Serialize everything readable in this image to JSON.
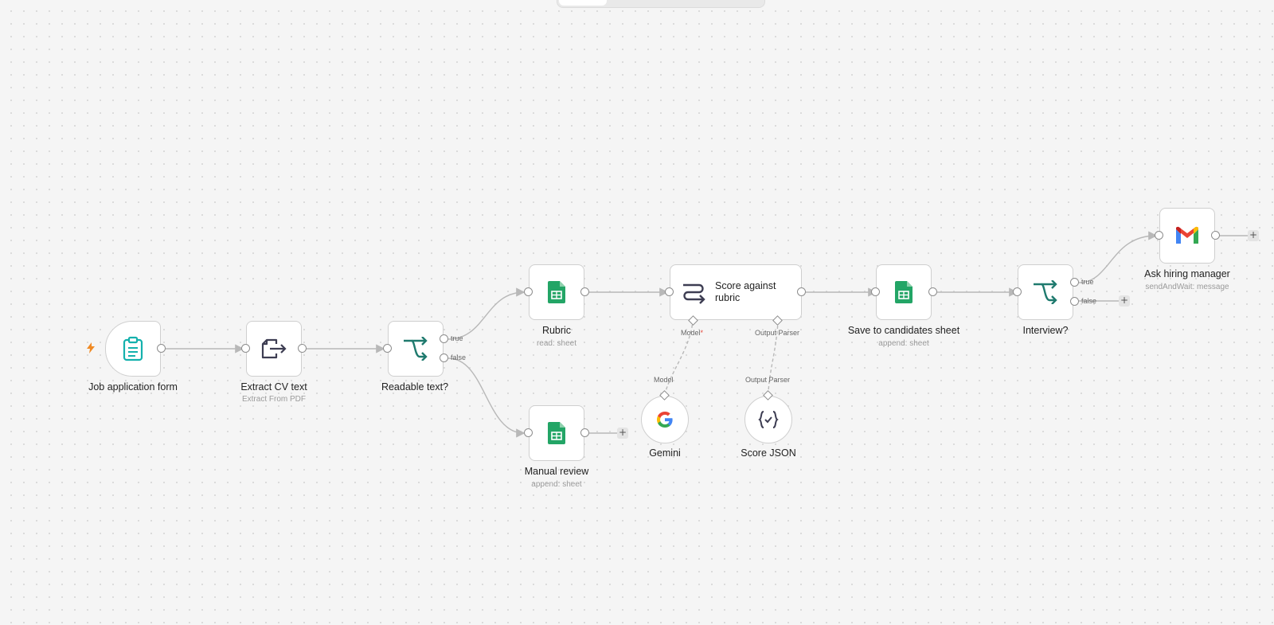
{
  "colors": {
    "canvas": "#f5f5f5",
    "edge": "#b8b8b8",
    "trigger_bolt": "#f08a24",
    "form_icon": "#14b1ad",
    "router_icon": "#1f7a6e",
    "sheets_green": "#23a566"
  },
  "nodes": {
    "job_form": {
      "label": "Job application form",
      "icon": "clipboard-icon"
    },
    "extract": {
      "label": "Extract CV text",
      "sub": "Extract From PDF",
      "icon": "file-export-icon"
    },
    "readable": {
      "label": "Readable text?",
      "icon": "if-branch-icon",
      "true_label": "true",
      "false_label": "false"
    },
    "rubric": {
      "label": "Rubric",
      "sub": "read: sheet",
      "icon": "google-sheets-icon"
    },
    "manual_review": {
      "label": "Manual review",
      "sub": "append: sheet",
      "icon": "google-sheets-icon"
    },
    "score": {
      "label": "Score against rubric",
      "icon": "llm-chain-icon",
      "model_port": "Model",
      "model_required": "*",
      "parser_port": "Output Parser"
    },
    "gemini": {
      "label": "Gemini",
      "port": "Model",
      "icon": "google-g-icon"
    },
    "score_json": {
      "label": "Score JSON",
      "port": "Output Parser",
      "icon": "json-braces-icon"
    },
    "save": {
      "label": "Save to candidates sheet",
      "sub": "append: sheet",
      "icon": "google-sheets-icon"
    },
    "interview": {
      "label": "Interview?",
      "icon": "if-branch-icon",
      "true_label": "true",
      "false_label": "false"
    },
    "ask": {
      "label": "Ask hiring manager",
      "sub": "sendAndWait: message",
      "icon": "gmail-icon"
    }
  },
  "plus_symbol": "+"
}
